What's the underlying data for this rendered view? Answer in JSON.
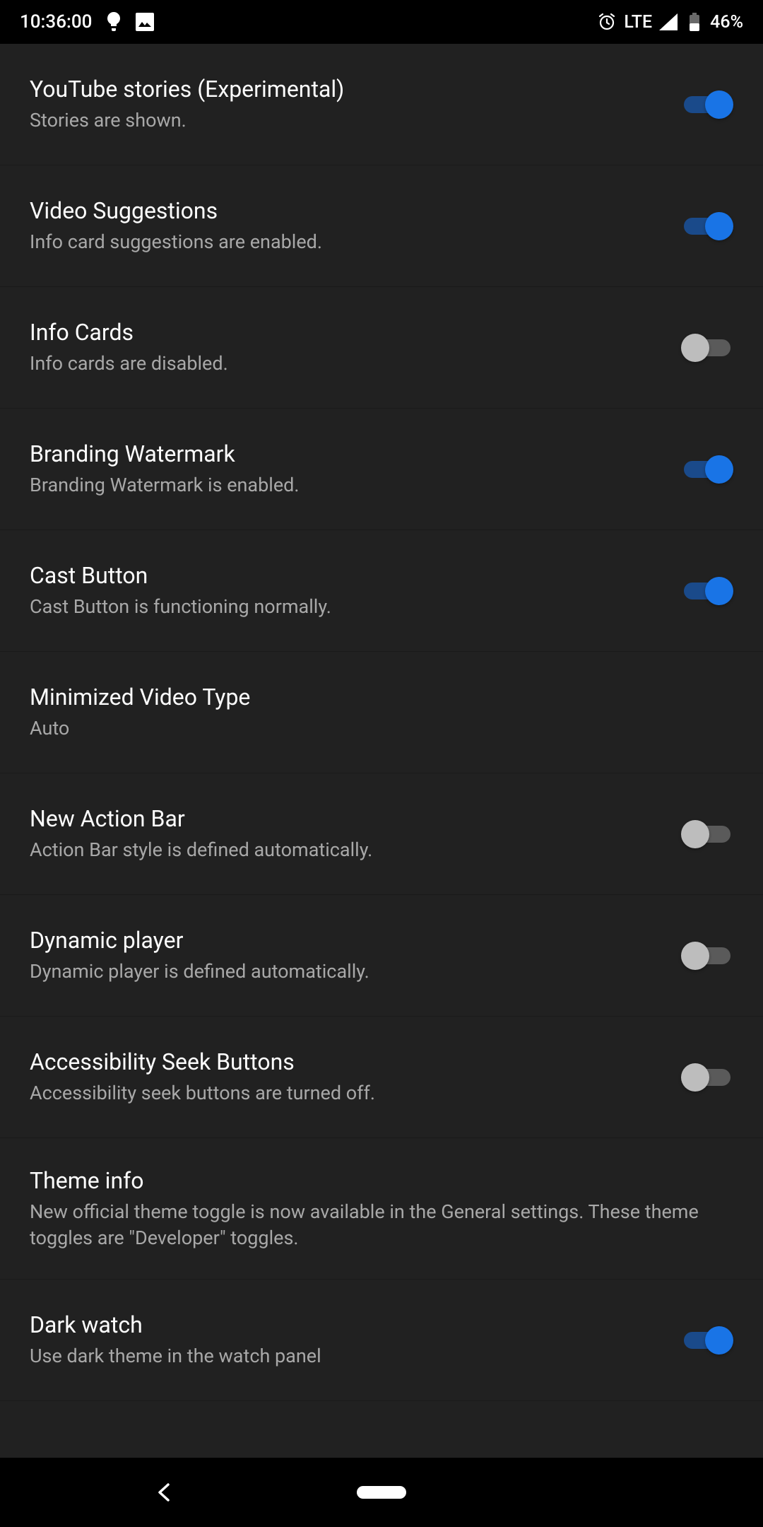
{
  "status": {
    "time": "10:36:00",
    "network": "LTE",
    "battery": "46%"
  },
  "settings": [
    {
      "key": "youtube-stories",
      "title": "YouTube stories (Experimental)",
      "desc": "Stories are shown.",
      "toggle": "on"
    },
    {
      "key": "video-suggestions",
      "title": "Video Suggestions",
      "desc": "Info card suggestions are enabled.",
      "toggle": "on"
    },
    {
      "key": "info-cards",
      "title": "Info Cards",
      "desc": "Info cards are disabled.",
      "toggle": "off"
    },
    {
      "key": "branding-watermark",
      "title": "Branding Watermark",
      "desc": "Branding Watermark is enabled.",
      "toggle": "on"
    },
    {
      "key": "cast-button",
      "title": "Cast Button",
      "desc": "Cast Button is functioning normally.",
      "toggle": "on"
    },
    {
      "key": "minimized-video-type",
      "title": "Minimized Video Type",
      "desc": "Auto",
      "toggle": null
    },
    {
      "key": "new-action-bar",
      "title": "New Action Bar",
      "desc": "Action Bar style is defined automatically.",
      "toggle": "off"
    },
    {
      "key": "dynamic-player",
      "title": "Dynamic player",
      "desc": "Dynamic player is defined automatically.",
      "toggle": "off"
    },
    {
      "key": "accessibility-seek-buttons",
      "title": "Accessibility Seek Buttons",
      "desc": "Accessibility seek buttons are turned off.",
      "toggle": "off"
    },
    {
      "key": "theme-info",
      "title": "Theme info",
      "desc": "New official theme toggle is now available in the General settings. These theme toggles are \"Developer\" toggles.",
      "toggle": null
    },
    {
      "key": "dark-watch",
      "title": "Dark watch",
      "desc": "Use dark theme in the watch panel",
      "toggle": "on"
    }
  ]
}
